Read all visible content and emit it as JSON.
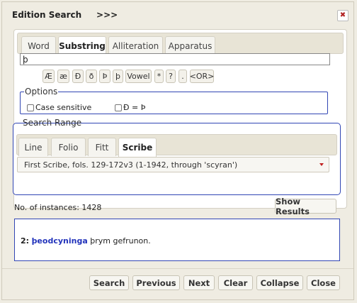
{
  "window": {
    "title": "Edition Search     >>>",
    "close_glyph": "✖"
  },
  "tabs": [
    "Word",
    "Substring",
    "Alliteration",
    "Apparatus"
  ],
  "search": {
    "value": "þ"
  },
  "char_buttons": [
    "Æ",
    "æ",
    "Ð",
    "ð",
    "Þ",
    "þ",
    "Vowel",
    "*",
    "?",
    ".",
    "<OR>"
  ],
  "options": {
    "legend": "Options",
    "case_sensitive": "Case sensitive",
    "eth_thorn": "Ð = Þ"
  },
  "range": {
    "legend": "Search Range",
    "tabs": [
      "Line",
      "Folio",
      "Fitt",
      "Scribe"
    ],
    "selected": "First Scribe, fols. 129-172v3 (1-1942, through 'scyran')"
  },
  "instances": "No. of instances: 1428",
  "show_results": "Show Results",
  "result": {
    "number": "2:",
    "match": "þeodcyninga",
    "rest": " þrym gefrunon."
  },
  "footer_buttons": [
    "Search",
    "Previous",
    "Next",
    "Clear",
    "Collapse",
    "Close"
  ],
  "colors": {
    "accent_border": "#3146b4",
    "link": "#2233bb",
    "close_x": "#b22222"
  }
}
